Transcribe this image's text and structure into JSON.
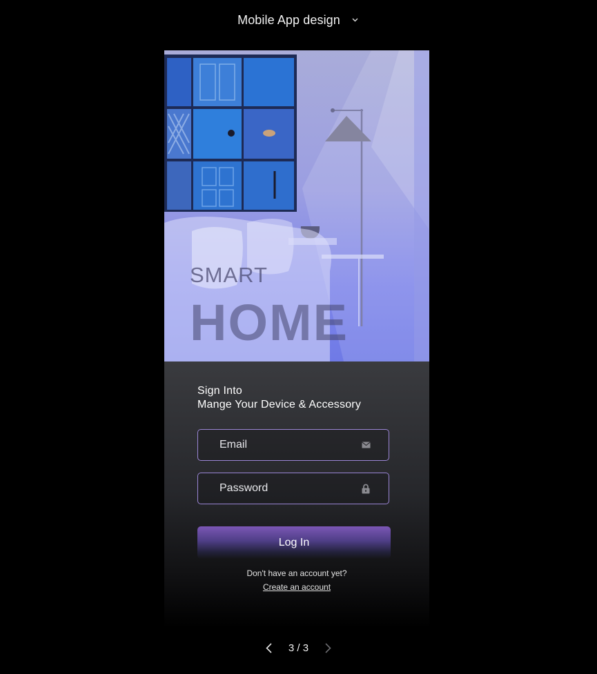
{
  "header": {
    "title": "Mobile App design",
    "dropdown_icon": "chevron-down-icon"
  },
  "hero": {
    "line1": "SMART",
    "line2": "HOME",
    "image": "living-room-with-blue-door-collage"
  },
  "signin": {
    "heading_line1": "Sign Into",
    "heading_line2": "Mange Your Device & Accessory",
    "email_placeholder": "Email",
    "email_icon": "mail-icon",
    "password_placeholder": "Password",
    "password_icon": "lock-icon",
    "login_label": "Log In",
    "no_account_text": "Don't have an account yet?",
    "create_account_link": "Create an account"
  },
  "pager": {
    "current": "3 / 3",
    "prev_icon": "chevron-left-icon",
    "next_icon": "chevron-right-icon"
  },
  "colors": {
    "background": "#000000",
    "hero_blue": "#7f86ea",
    "field_border": "#9b86d6",
    "button_purple": "#7b57b5"
  }
}
